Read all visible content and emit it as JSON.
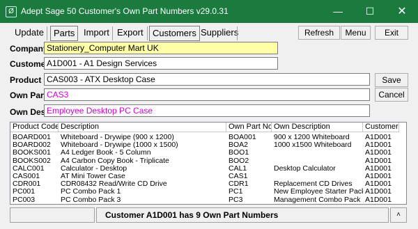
{
  "window": {
    "title": "Adept Sage 50 Customer's Own Part Numbers v29.0.31",
    "app_icon": "Ø",
    "minimize": "—",
    "maximize": "☐",
    "close": "✕"
  },
  "menu": {
    "update": "Update",
    "parts": "Parts",
    "import": "Import",
    "export": "Export",
    "customers": "Customers",
    "suppliers": "Suppliers",
    "refresh": "Refresh",
    "menu": "Menu",
    "exit": "Exit"
  },
  "form": {
    "company_label": "Company",
    "company_value": "Stationery_Computer Mart UK",
    "customer_label": "Customer",
    "customer_value": "A1D001 - A1 Design Services",
    "product_label": "Product",
    "product_value": "CAS003 - ATX Desktop Case",
    "own_part_label": "Own Part",
    "own_part_value": "CAS3",
    "own_desc_label": "Own Desc",
    "own_desc_value": "Employee Desktop PC Case",
    "save": "Save",
    "cancel": "Cancel"
  },
  "grid": {
    "headers": [
      "Product Code",
      "Description",
      "Own Part No",
      "Own Description",
      "Customer"
    ],
    "rows": [
      [
        "BOARD001",
        "Whiteboard - Drywipe (900 x 1200)",
        "BOA001",
        "900 x 1200 Whiteboard",
        "A1D001"
      ],
      [
        "BOARD002",
        "Whiteboard - Drywipe (1000 x 1500)",
        "BOA2",
        "1000 x1500 Whiteboard",
        "A1D001"
      ],
      [
        "BOOKS001",
        "A4 Ledger Book - 5 Column",
        "BOO1",
        "",
        "A1D001"
      ],
      [
        "BOOKS002",
        "A4 Carbon Copy Book - Triplicate",
        "BOO2",
        "",
        "A1D001"
      ],
      [
        "CALC001",
        "Calculator - Desktop",
        "CAL1",
        "Desktop Calculator",
        "A1D001"
      ],
      [
        "CAS001",
        "AT Mini Tower Case",
        "CAS1",
        "",
        "A1D001"
      ],
      [
        "CDR001",
        "CDR08432 Read/Write CD Drive",
        "CDR1",
        "Replacement CD Drives",
        "A1D001"
      ],
      [
        "PC001",
        "PC Combo Pack 1",
        "PC1",
        "New Employee Starter Pack",
        "A1D001"
      ],
      [
        "PC003",
        "PC Combo Pack 3",
        "PC3",
        "Management Combo Pack",
        "A1D001"
      ]
    ]
  },
  "status": {
    "message": "Customer A1D001 has 9 Own Part Numbers",
    "scroll_up": "˄"
  }
}
